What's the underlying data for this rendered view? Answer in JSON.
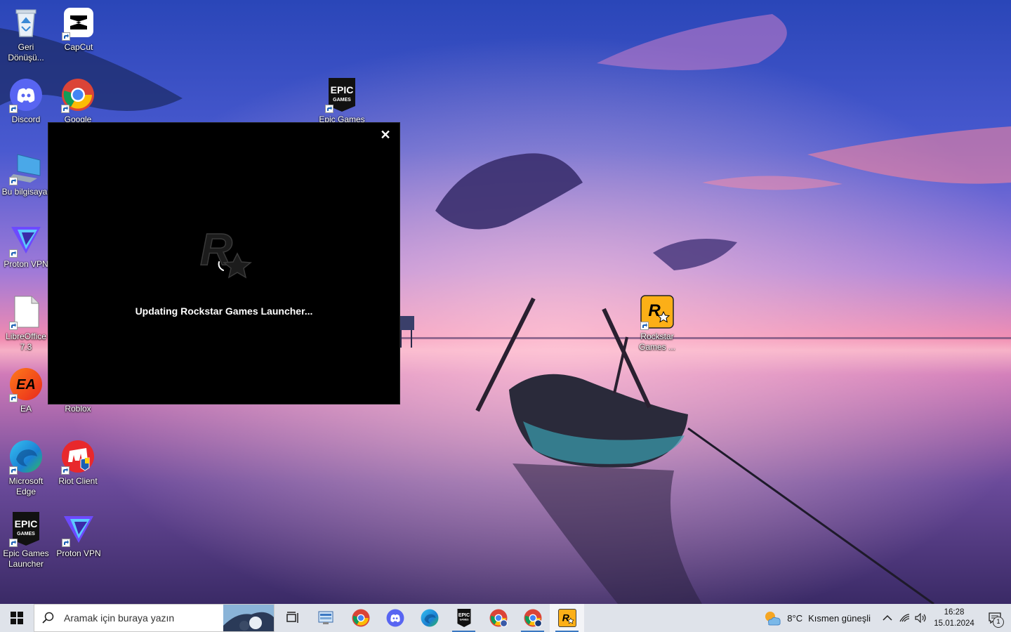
{
  "desktop": {
    "icons": [
      {
        "id": "recycle",
        "label": "Geri Dönüşü..."
      },
      {
        "id": "capcut",
        "label": "CapCut"
      },
      {
        "id": "discord",
        "label": "Discord"
      },
      {
        "id": "chrome",
        "label": "Google"
      },
      {
        "id": "epic-top",
        "label": "Epic Games"
      },
      {
        "id": "thispc",
        "label": "Bu bilgisayar"
      },
      {
        "id": "proton1",
        "label": "Proton VPN"
      },
      {
        "id": "libreoffice",
        "label": "LibreOffice 7.3"
      },
      {
        "id": "ea",
        "label": "EA"
      },
      {
        "id": "roblox",
        "label": "Roblox"
      },
      {
        "id": "rockstar",
        "label": "Rockstar Games ..."
      },
      {
        "id": "edge",
        "label": "Microsoft Edge"
      },
      {
        "id": "riot",
        "label": "Riot Client"
      },
      {
        "id": "epic-bottom",
        "label": "Epic Games Launcher"
      },
      {
        "id": "proton2",
        "label": "Proton VPN"
      }
    ]
  },
  "launcher": {
    "status": "Updating Rockstar Games Launcher...",
    "close_glyph": "✕"
  },
  "taskbar": {
    "search_placeholder": "Aramak için buraya yazın",
    "weather_temp": "8°C",
    "weather_desc": "Kısmen güneşli",
    "time": "16:28",
    "date": "15.01.2024",
    "notification_count": "1"
  },
  "colors": {
    "taskbar": "#dfe3ea",
    "launcher_bg": "#000000",
    "accent": "#3a78c2"
  }
}
